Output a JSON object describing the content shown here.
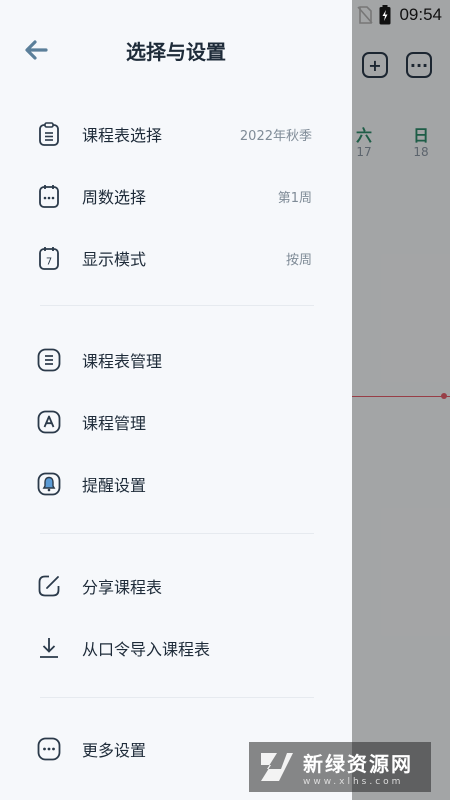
{
  "status_bar": {
    "time": "09:54",
    "icons": [
      "wifi-icon",
      "no-sim-icon",
      "battery-charging-icon"
    ]
  },
  "background_app": {
    "top_buttons": [
      "add-icon",
      "more-icon"
    ],
    "days": [
      {
        "label": "六",
        "date": "17"
      },
      {
        "label": "日",
        "date": "18"
      }
    ],
    "colors": {
      "day_accent": "#2e8b6b",
      "time_line": "#e35d6a"
    }
  },
  "drawer": {
    "title": "选择与设置",
    "back_icon": "arrow-left-icon",
    "section_selection": [
      {
        "icon": "clipboard-list-icon",
        "label": "课程表选择",
        "value": "2022年秋季"
      },
      {
        "icon": "calendar-dots-icon",
        "label": "周数选择",
        "value": "第1周"
      },
      {
        "icon": "calendar-seven-icon",
        "label": "显示模式",
        "value": "按周"
      }
    ],
    "section_manage": [
      {
        "icon": "list-box-icon",
        "label": "课程表管理"
      },
      {
        "icon": "letter-a-box-icon",
        "label": "课程管理"
      },
      {
        "icon": "bell-box-icon",
        "label": "提醒设置"
      }
    ],
    "section_share": [
      {
        "icon": "share-edit-icon",
        "label": "分享课程表"
      },
      {
        "icon": "download-icon",
        "label": "从口令导入课程表"
      }
    ],
    "section_more": [
      {
        "icon": "more-box-icon",
        "label": "更多设置"
      }
    ]
  },
  "watermark": {
    "title": "新绿资源网",
    "subtitle": "www.xlhs.com"
  },
  "colors": {
    "accent": "#5b7f9a",
    "text": "#1e2b39",
    "secondary": "#7f8b97"
  }
}
